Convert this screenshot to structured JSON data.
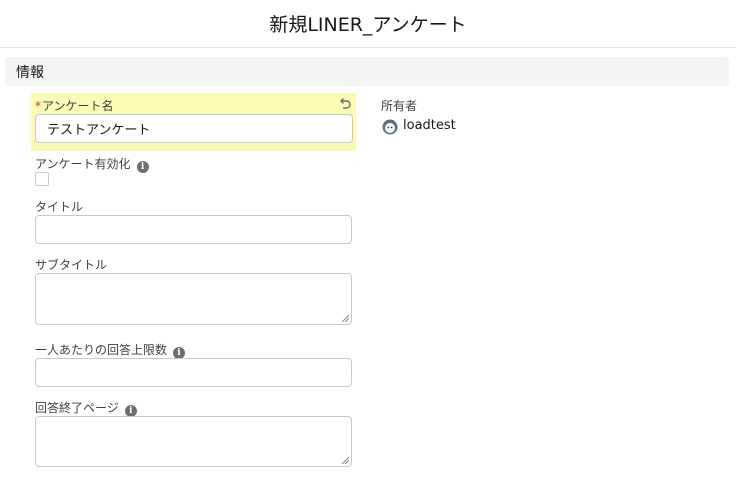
{
  "header": {
    "title": "新規LINER_アンケート"
  },
  "section": {
    "label": "情報"
  },
  "fields": {
    "survey_name": {
      "required_mark": "*",
      "label": "アンケート名",
      "value": "テストアンケート"
    },
    "survey_enabled": {
      "label": "アンケート有効化",
      "info_icon": "i",
      "checked": false
    },
    "title": {
      "label": "タイトル",
      "value": ""
    },
    "subtitle": {
      "label": "サブタイトル",
      "value": ""
    },
    "max_answers": {
      "label": "一人あたりの回答上限数",
      "info_icon": "i",
      "value": ""
    },
    "end_page": {
      "label": "回答終了ページ",
      "info_icon": "i",
      "value": ""
    }
  },
  "owner": {
    "label": "所有者",
    "name": "loadtest"
  },
  "icons": {
    "undo": "undo-icon",
    "info": "info-icon",
    "avatar": "user-avatar-icon"
  },
  "colors": {
    "highlight": "#fafab4",
    "required": "#c23934",
    "section_bg": "#f3f3f3"
  }
}
